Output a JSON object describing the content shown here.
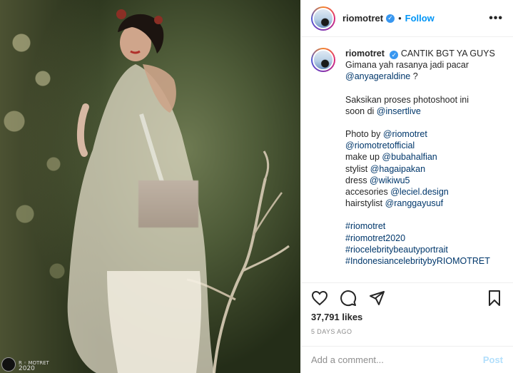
{
  "post": {
    "username": "riomotret",
    "follow_label": "Follow",
    "dot": "•",
    "more_label": "•••",
    "verified_mark": "✓"
  },
  "photo": {
    "credit_line1": "R ◦ MOTRET",
    "credit_line2": "2020"
  },
  "caption": {
    "username": "riomotret",
    "lines": [
      {
        "text": "CANTIK BGT YA GUYS"
      },
      {
        "text": "Gimana yah rasanya jadi pacar"
      },
      {
        "mention": "@anyageraldine",
        "suffix": " ?"
      },
      {
        "gap": true
      },
      {
        "text": "Saksikan proses photoshoot ini"
      },
      {
        "text": "soon di ",
        "mention": "@insertlive"
      },
      {
        "gap": true
      },
      {
        "text": "Photo by ",
        "mention": "@riomotret"
      },
      {
        "mention": "@riomotretofficial"
      },
      {
        "text": "make up ",
        "mention": "@bubahalfian"
      },
      {
        "text": "stylist ",
        "mention": "@hagaipakan"
      },
      {
        "text": "dress ",
        "mention": "@wikiwu5"
      },
      {
        "text": "accesories ",
        "mention": "@leciel.design"
      },
      {
        "text": "hairstylist ",
        "mention": "@ranggayusuf"
      },
      {
        "gap": true
      },
      {
        "mention": "#riomotret"
      },
      {
        "mention": "#riomotret2020"
      },
      {
        "mention": "#riocelebritybeautyportrait"
      },
      {
        "mention": "#IndonesiancelebritybyRIOMOTRET"
      }
    ]
  },
  "actions": {
    "like_icon": "heart-icon",
    "comment_icon": "comment-icon",
    "share_icon": "share-icon",
    "save_icon": "bookmark-icon"
  },
  "likes_label": "37,791 likes",
  "time_label": "5 DAYS AGO",
  "comment": {
    "placeholder": "Add a comment...",
    "post_label": "Post"
  },
  "colors": {
    "link": "#00376b",
    "follow": "#0095f6",
    "post_disabled": "#b2dffc"
  }
}
